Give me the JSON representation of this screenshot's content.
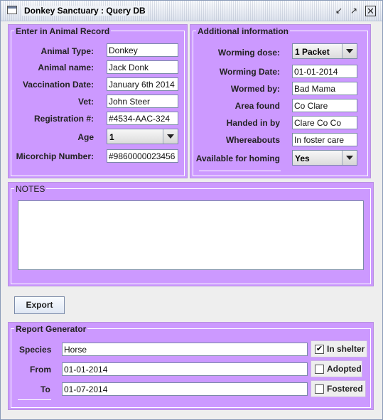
{
  "window": {
    "title": "Donkey Sanctuary : Query DB"
  },
  "animal_record": {
    "title": "Enter in Animal Record",
    "animal_type_label": "Animal Type:",
    "animal_type_value": "Donkey",
    "animal_name_label": "Animal name:",
    "animal_name_value": "Jack Donk",
    "vaccination_label": "Vaccination Date:",
    "vaccination_value": "January 6th 2014",
    "vet_label": "Vet:",
    "vet_value": "John Steer",
    "registration_label": "Registration #:",
    "registration_value": "#4534-AAC-324",
    "age_label": "Age",
    "age_value": "1",
    "microchip_label": "Micorchip Number:",
    "microchip_value": "#9860000023456"
  },
  "additional": {
    "title": "Additional information",
    "worming_dose_label": "Worming dose:",
    "worming_dose_value": "1 Packet",
    "worming_date_label": "Worming Date:",
    "worming_date_value": "01-01-2014",
    "wormed_by_label": "Wormed by:",
    "wormed_by_value": "Bad Mama",
    "area_found_label": "Area found",
    "area_found_value": "Co Clare",
    "handed_in_label": "Handed in by",
    "handed_in_value": "Clare Co Co",
    "whereabouts_label": "Whereabouts",
    "whereabouts_value": "In foster care",
    "homing_label": "Available for homing",
    "homing_value": "Yes"
  },
  "notes": {
    "title": "NOTES",
    "value": ""
  },
  "export_button": "Export",
  "report": {
    "title": "Report Generator",
    "species_label": "Species",
    "species_value": "Horse",
    "from_label": "From",
    "from_value": " 01-01-2014",
    "to_label": "To",
    "to_value": " 01-07-2014",
    "in_shelter_label": "In shelter",
    "in_shelter_checked": true,
    "adopted_label": "Adopted",
    "adopted_checked": false,
    "fostered_label": "Fostered",
    "fostered_checked": false
  },
  "icons": {
    "window_icon": "window-icon",
    "minimize": "minimize-icon",
    "maximize": "maximize-icon",
    "close": "close-icon",
    "dropdown": "chevron-down-icon",
    "check": "checkmark-icon"
  },
  "colors": {
    "panel": "#cc99ff",
    "background": "#eeeeee"
  }
}
